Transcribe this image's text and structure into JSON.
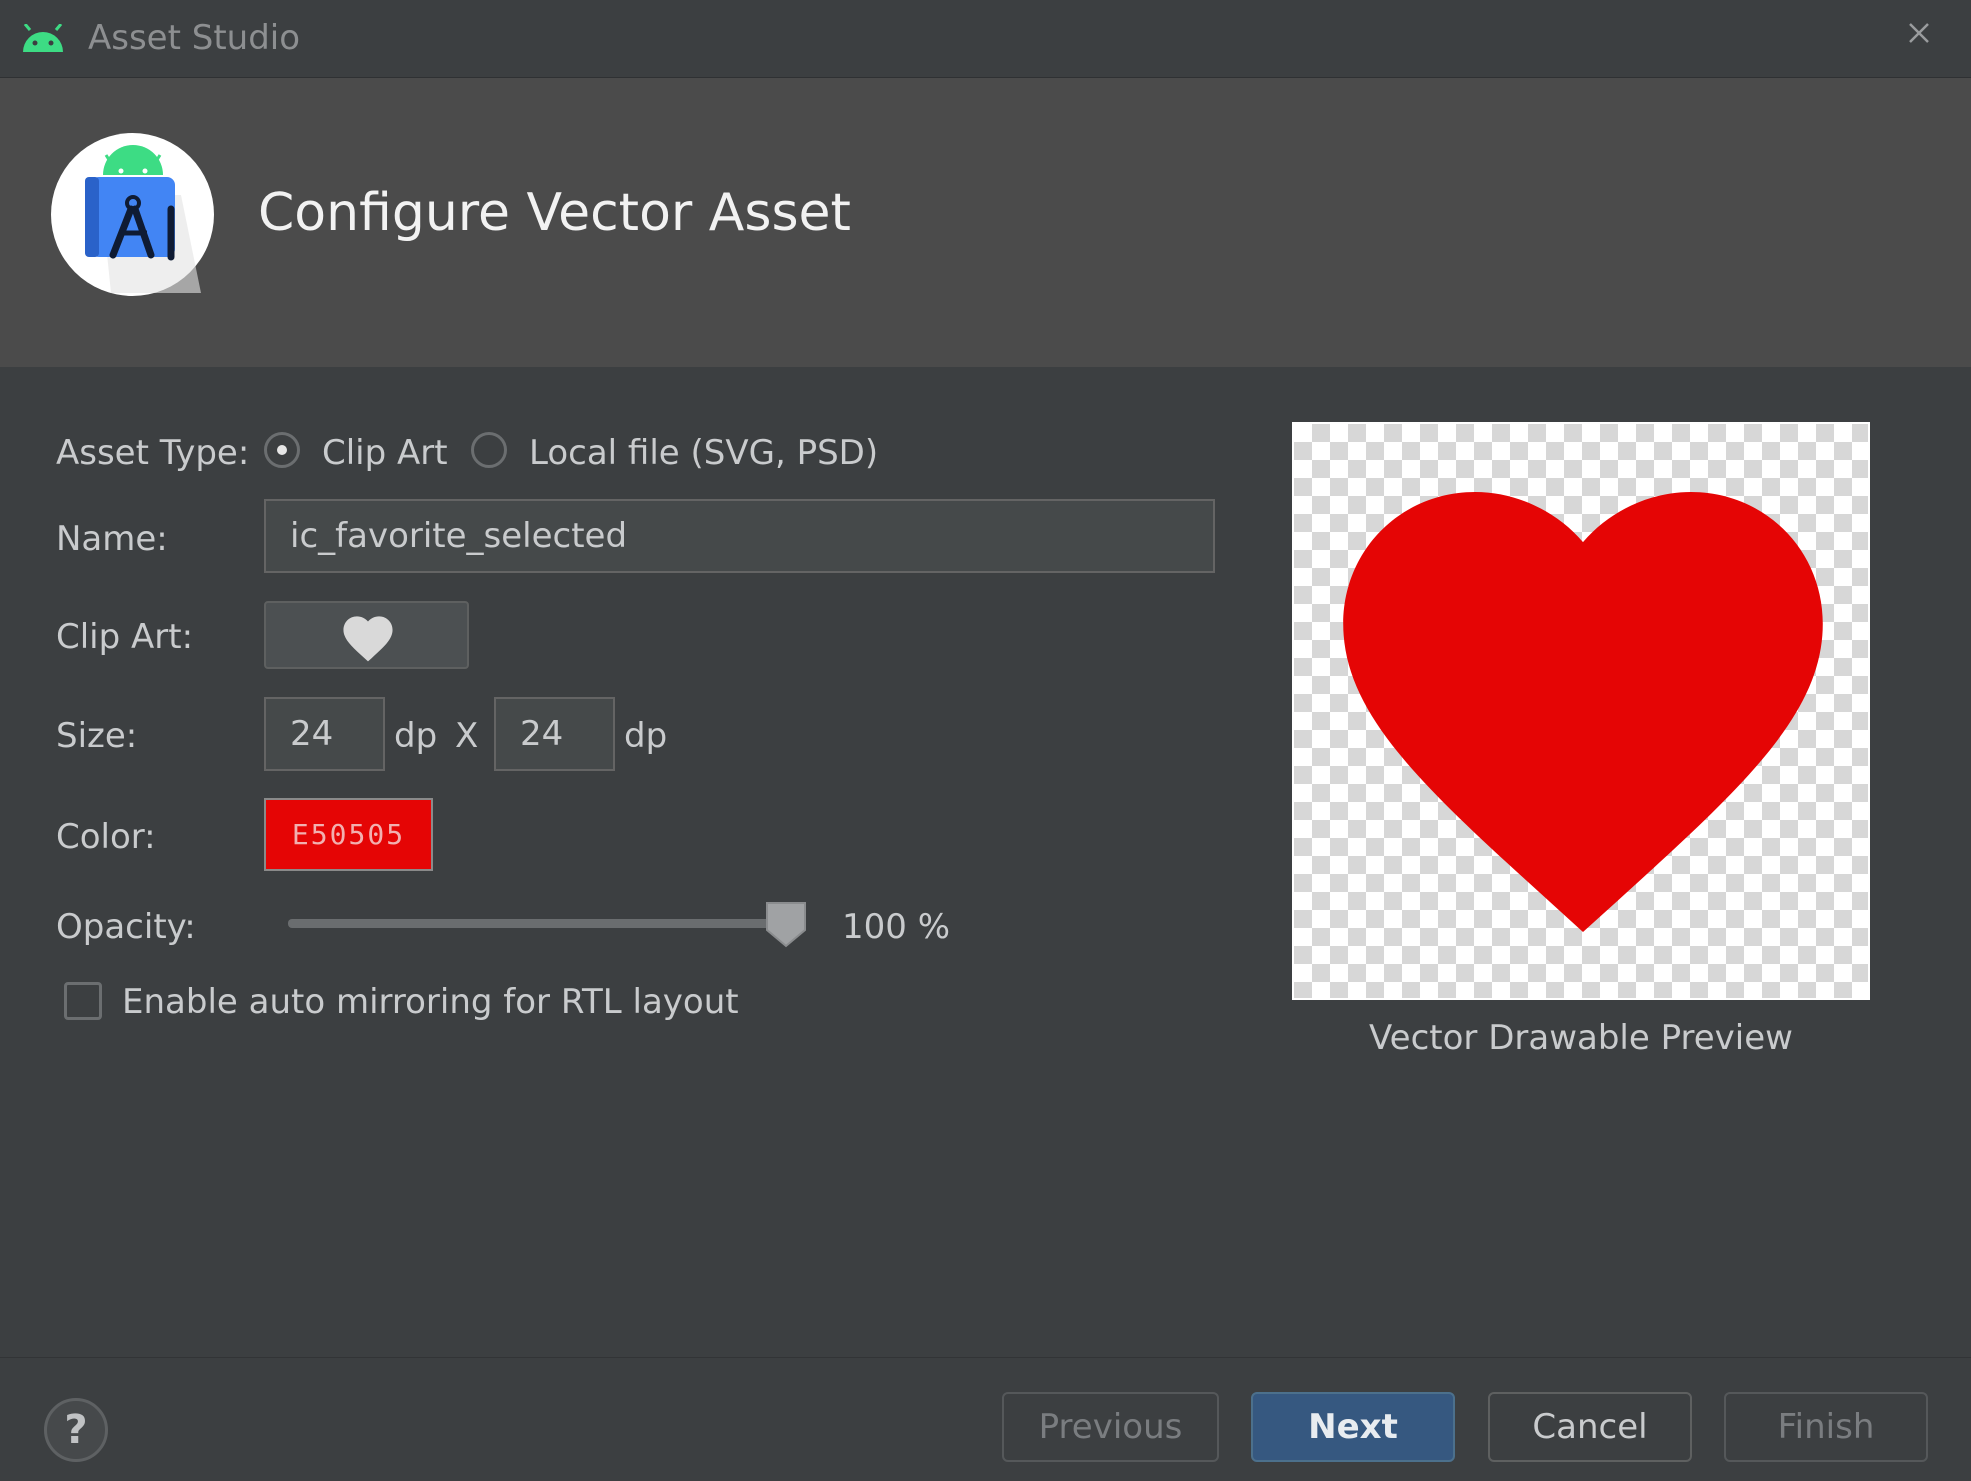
{
  "window": {
    "title": "Asset Studio",
    "close_icon": "close-icon"
  },
  "header": {
    "title": "Configure Vector Asset",
    "logo_icon": "android-studio-logo"
  },
  "form": {
    "asset_type_label": "Asset Type:",
    "asset_type_options": [
      {
        "label": "Clip Art",
        "selected": true
      },
      {
        "label": "Local file (SVG, PSD)",
        "selected": false
      }
    ],
    "name_label": "Name:",
    "name_value": "ic_favorite_selected",
    "clip_art_label": "Clip Art:",
    "clip_art_icon": "heart-icon",
    "size_label": "Size:",
    "width_value": "24",
    "width_unit": "dp",
    "size_separator": "X",
    "height_value": "24",
    "height_unit": "dp",
    "color_label": "Color:",
    "color_value": "E50505",
    "color_hex": "#E50505",
    "opacity_label": "Opacity:",
    "opacity_percent": 100,
    "opacity_text": "100 %",
    "auto_mirror_label": "Enable auto mirroring for RTL layout",
    "auto_mirror_checked": false
  },
  "preview": {
    "caption": "Vector Drawable Preview",
    "icon": "heart-icon",
    "color": "#E50505"
  },
  "footer": {
    "help_label": "?",
    "previous_label": "Previous",
    "next_label": "Next",
    "cancel_label": "Cancel",
    "finish_label": "Finish"
  }
}
